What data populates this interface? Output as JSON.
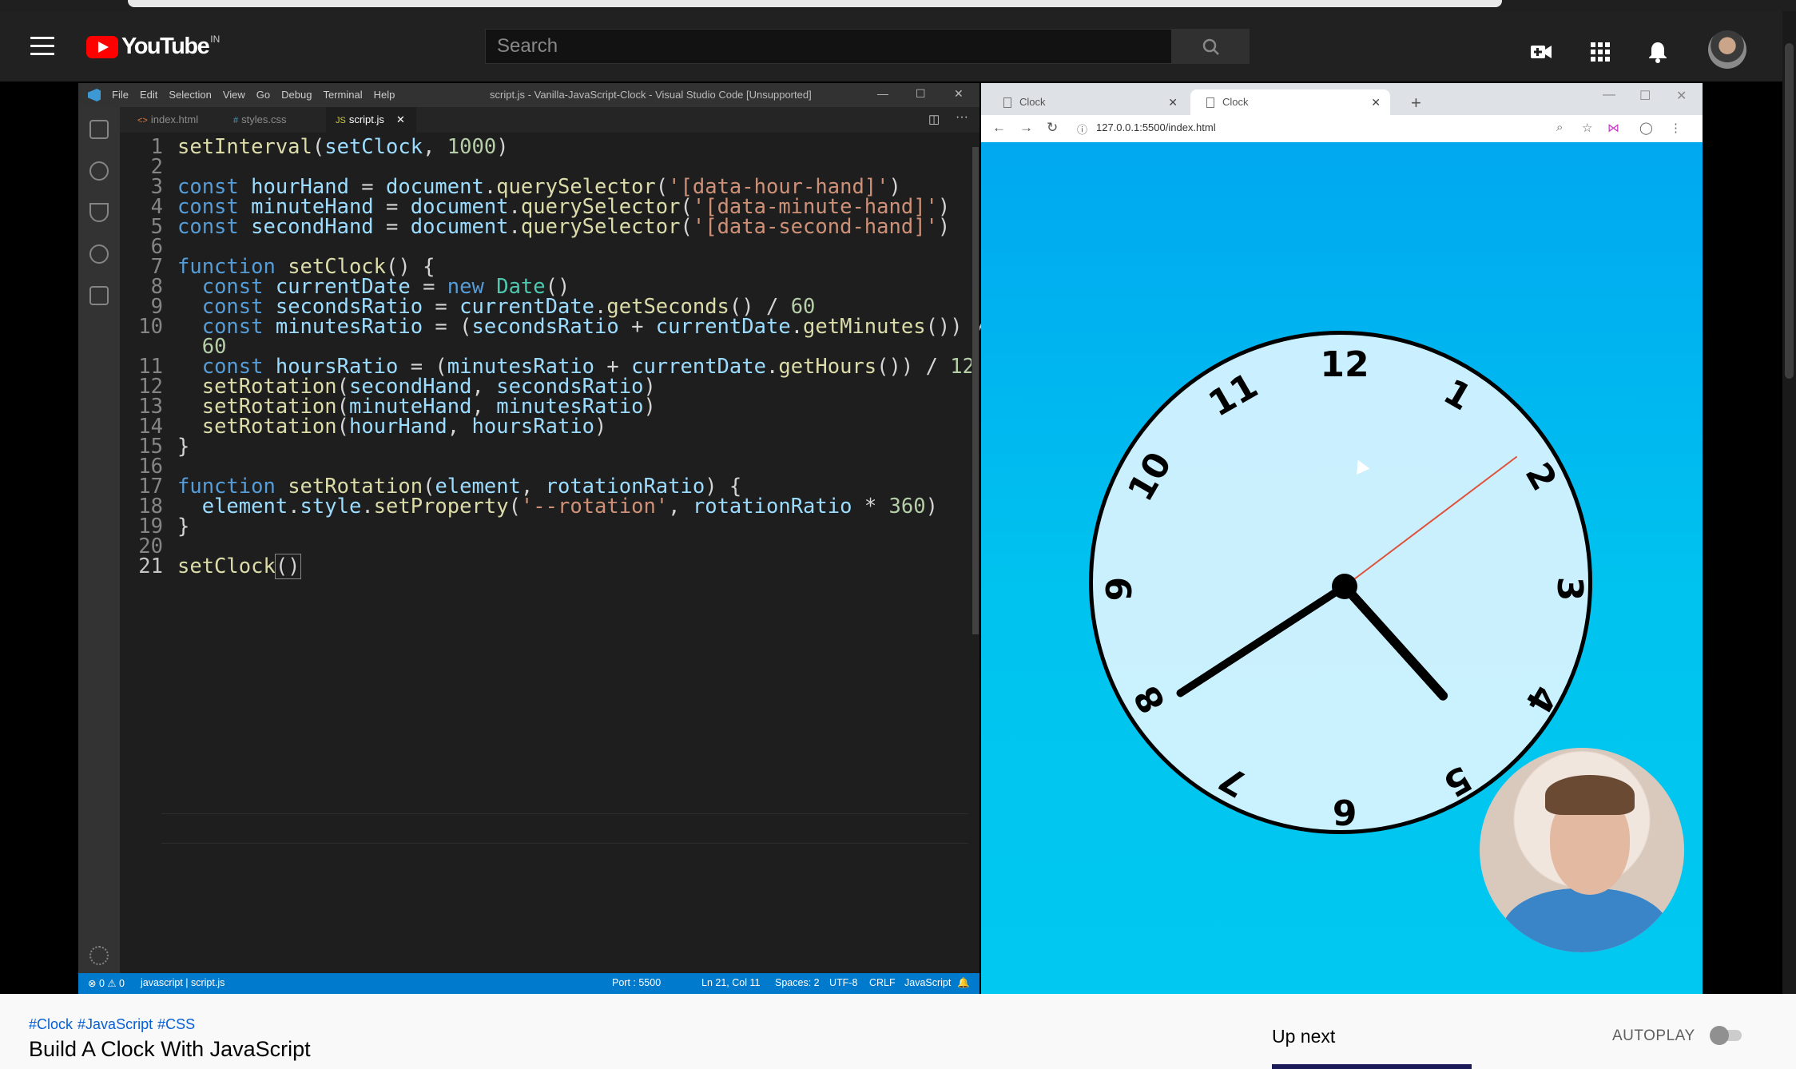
{
  "header": {
    "logo_text": "YouTube",
    "region": "IN",
    "search_placeholder": "Search"
  },
  "vscode": {
    "menus": [
      "File",
      "Edit",
      "Selection",
      "View",
      "Go",
      "Debug",
      "Terminal",
      "Help"
    ],
    "window_title": "script.js - Vanilla-JavaScript-Clock - Visual Studio Code [Unsupported]",
    "tabs": [
      {
        "label": "index.html",
        "icon": "<>"
      },
      {
        "label": "styles.css",
        "icon": "#"
      },
      {
        "label": "script.js",
        "icon": "JS"
      }
    ],
    "line_numbers": [
      "1",
      "2",
      "3",
      "4",
      "5",
      "6",
      "7",
      "8",
      "9",
      "10",
      "",
      "11",
      "12",
      "13",
      "14",
      "15",
      "16",
      "17",
      "18",
      "19",
      "20",
      "21"
    ],
    "status": {
      "left": "⊗ 0 ⚠ 0",
      "branch": "javascript | script.js",
      "port": "Port : 5500",
      "position": "Ln 21, Col 11",
      "spaces": "Spaces: 2",
      "encoding": "UTF-8",
      "eol": "CRLF",
      "language": "JavaScript"
    }
  },
  "browser": {
    "tabs": [
      {
        "label": "Clock"
      },
      {
        "label": "Clock"
      }
    ],
    "url": "127.0.0.1:5500/index.html"
  },
  "clock": {
    "numbers": [
      "12",
      "1",
      "2",
      "3",
      "4",
      "5",
      "6",
      "7",
      "8",
      "9",
      "10",
      "11"
    ],
    "hand_angles_deg": {
      "hour": 138,
      "minute": 237,
      "second": 53
    }
  },
  "video_info": {
    "hashtags": [
      "#Clock",
      "#JavaScript",
      "#CSS"
    ],
    "title": "Build A Clock With JavaScript"
  },
  "sidebar": {
    "up_next": "Up next",
    "autoplay": "AUTOPLAY"
  },
  "colors": {
    "yt_red": "#ff0000",
    "vscode_blue": "#007acc",
    "clock_bg": "#00b8f0"
  }
}
